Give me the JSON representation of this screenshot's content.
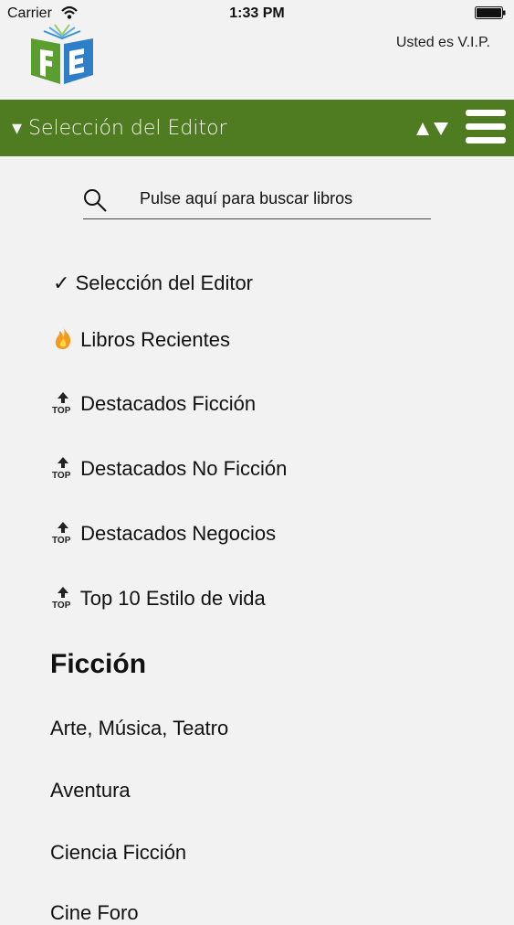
{
  "status_bar": {
    "carrier": "Carrier",
    "time": "1:33 PM"
  },
  "header": {
    "vip_label": "Usted es V.I.P."
  },
  "navbar": {
    "title": "▾ Selección del Editor",
    "accent": "#4f7b21"
  },
  "search": {
    "placeholder": "Pulse aquí para buscar libros"
  },
  "featured": [
    {
      "label": "Selección del Editor",
      "icon": "checkmark-icon",
      "mark": "✓"
    },
    {
      "label": "Libros Recientes",
      "icon": "fire-icon"
    },
    {
      "label": "Destacados Ficción",
      "icon": "top-icon"
    },
    {
      "label": "Destacados No Ficción",
      "icon": "top-icon"
    },
    {
      "label": "Destacados Negocios",
      "icon": "top-icon"
    },
    {
      "label": "Top 10 Estilo de vida",
      "icon": "top-icon"
    }
  ],
  "section": {
    "title": "Ficción"
  },
  "categories": [
    "Arte, Música, Teatro",
    "Aventura",
    "Ciencia Ficción",
    "Cine Foro"
  ]
}
